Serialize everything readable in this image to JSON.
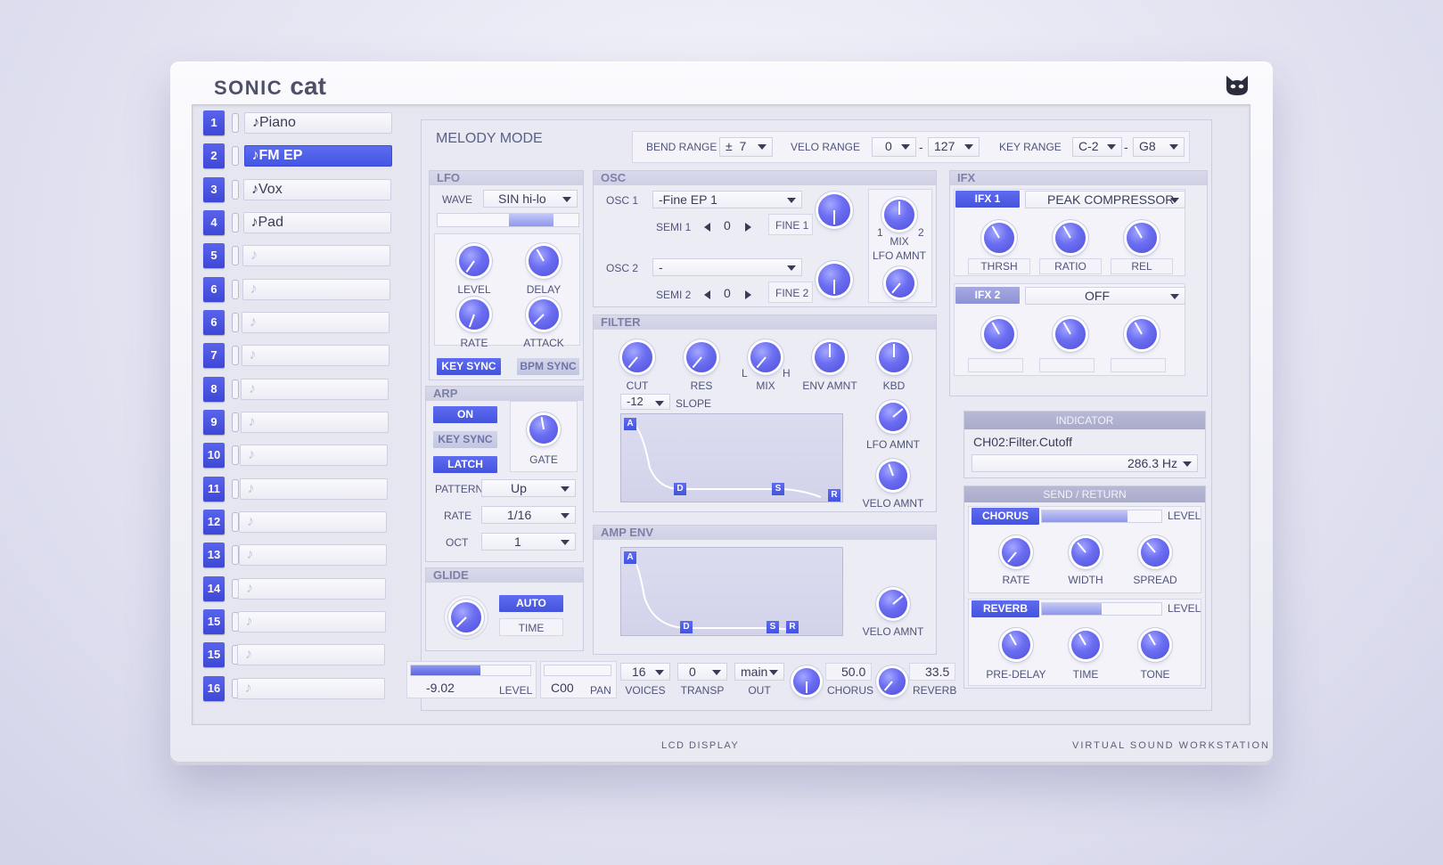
{
  "brand": {
    "prefix": "SONIC",
    "name": "cat"
  },
  "mode_title": "MELODY MODE",
  "header": {
    "bend_range": {
      "label": "BEND RANGE",
      "sign": "±",
      "value": "7"
    },
    "velo_range": {
      "label": "VELO RANGE",
      "low": "0",
      "dash": "-",
      "high": "127"
    },
    "key_range": {
      "label": "KEY RANGE",
      "low": "C-2",
      "dash": "-",
      "high": "G8"
    }
  },
  "channels": [
    {
      "num": "1",
      "name": "♪Piano"
    },
    {
      "num": "2",
      "name": "♪FM EP"
    },
    {
      "num": "3",
      "name": "♪Vox"
    },
    {
      "num": "4",
      "name": "♪Pad"
    },
    {
      "num": "5",
      "name": "♪"
    },
    {
      "num": "6",
      "name": "♪"
    },
    {
      "num": "6",
      "name": "♪"
    },
    {
      "num": "7",
      "name": "♪"
    },
    {
      "num": "8",
      "name": "♪"
    },
    {
      "num": "9",
      "name": "♪"
    },
    {
      "num": "10",
      "name": "♪"
    },
    {
      "num": "11",
      "name": "♪"
    },
    {
      "num": "12",
      "name": "♪"
    },
    {
      "num": "13",
      "name": "♪"
    },
    {
      "num": "14",
      "name": "♪"
    },
    {
      "num": "15",
      "name": "♪"
    },
    {
      "num": "15",
      "name": "♪"
    },
    {
      "num": "16",
      "name": "♪"
    }
  ],
  "lfo": {
    "title": "LFO",
    "wave_label": "WAVE",
    "wave": "SIN hi-lo",
    "level": "LEVEL",
    "delay": "DELAY",
    "rate": "RATE",
    "attack": "ATTACK",
    "key_sync": "KEY SYNC",
    "bpm_sync": "BPM SYNC"
  },
  "arp": {
    "title": "ARP",
    "on": "ON",
    "key_sync": "KEY SYNC",
    "latch": "LATCH",
    "gate": "GATE",
    "pattern_label": "PATTERN",
    "pattern": "Up",
    "rate_label": "RATE",
    "rate": "1/16",
    "oct_label": "OCT",
    "oct": "1"
  },
  "glide": {
    "title": "GLIDE",
    "auto": "AUTO",
    "time": "TIME"
  },
  "osc": {
    "title": "OSC",
    "osc1_label": "OSC 1",
    "osc1": "-Fine EP 1",
    "semi1_label": "SEMI 1",
    "semi1": "0",
    "fine1": "FINE 1",
    "osc2_label": "OSC 2",
    "osc2": "-",
    "semi2_label": "SEMI 2",
    "semi2": "0",
    "fine2": "FINE 2",
    "mix_1": "1",
    "mix": "MIX",
    "mix_2": "2",
    "lfo_amnt": "LFO AMNT"
  },
  "filter": {
    "title": "FILTER",
    "cut": "CUT",
    "res": "RES",
    "mix_l": "L",
    "mix": "MIX",
    "mix_h": "H",
    "env_amnt": "ENV AMNT",
    "kbd": "KBD",
    "slope_value": "-12",
    "slope": "SLOPE",
    "lfo_amnt": "LFO AMNT",
    "velo_amnt": "VELO AMNT",
    "pts": {
      "a": "A",
      "d": "D",
      "s": "S",
      "r": "R"
    }
  },
  "amp_env": {
    "title": "AMP ENV",
    "velo_amnt": "VELO AMNT",
    "pts": {
      "a": "A",
      "d": "D",
      "s": "S",
      "r": "R"
    }
  },
  "ifx": {
    "title": "IFX",
    "ifx1_label": "IFX 1",
    "ifx1": "PEAK COMPRESSOR",
    "thrsh": "THRSH",
    "ratio": "RATIO",
    "rel": "REL",
    "ifx2_label": "IFX 2",
    "ifx2": "OFF"
  },
  "indicator": {
    "title": "INDICATOR",
    "param": "CH02:Filter.Cutoff",
    "value": "286.3 Hz"
  },
  "send_return": {
    "title": "SEND / RETURN",
    "chorus": "CHORUS",
    "chorus_level": "LEVEL",
    "rate": "RATE",
    "width": "WIDTH",
    "spread": "SPREAD",
    "reverb": "REVERB",
    "reverb_level": "LEVEL",
    "pre_delay": "PRE-DELAY",
    "time": "TIME",
    "tone": "TONE",
    "chorus_level_fill": 0.72,
    "reverb_level_fill": 0.5
  },
  "bottom": {
    "level_value": "-9.02",
    "level": "LEVEL",
    "level_fill": 0.58,
    "pan_value": "C00",
    "pan": "PAN",
    "voices_value": "16",
    "voices": "VOICES",
    "transp_value": "0",
    "transp": "TRANSP",
    "out_value": "main",
    "out": "OUT",
    "chorus_value": "50.0",
    "chorus": "CHORUS",
    "reverb_value": "33.5",
    "reverb": "REVERB"
  },
  "footer": {
    "lcd": "LCD DISPLAY",
    "tagline": "VIRTUAL SOUND WORKSTATION"
  },
  "colors": {
    "accent": "#4a58e6",
    "panel": "#ececf5",
    "knob": "#6d6ff2"
  },
  "icons": {
    "logo": "cat-head-icon"
  }
}
